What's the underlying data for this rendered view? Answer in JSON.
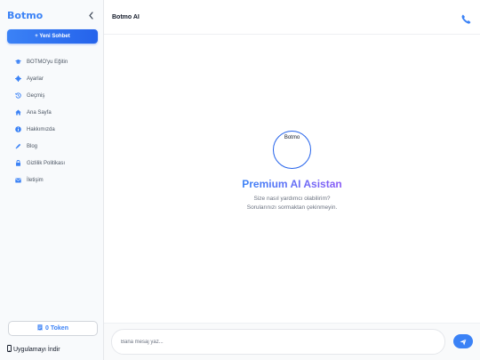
{
  "sidebar": {
    "brand": "Botmo",
    "new_chat_label": "+ Yeni Sohbet",
    "items": [
      {
        "label": "BOTMO'yu Eğitin",
        "icon": "graduation-cap-icon"
      },
      {
        "label": "Ayarlar",
        "icon": "gear-icon"
      },
      {
        "label": "Geçmiş",
        "icon": "history-icon"
      },
      {
        "label": "Ana Sayfa",
        "icon": "home-icon"
      },
      {
        "label": "Hakkımızda",
        "icon": "info-icon"
      },
      {
        "label": "Blog",
        "icon": "blog-icon"
      },
      {
        "label": "Gizlilik Politikası",
        "icon": "lock-icon"
      },
      {
        "label": "İletişim",
        "icon": "envelope-icon"
      }
    ],
    "token_label": "0 Token",
    "download_label": "Uygulamayı İndir"
  },
  "topbar": {
    "title": "Botmo AI"
  },
  "hero": {
    "logo_text": "Botmo",
    "title": "Premium AI Asistan",
    "subtitle_line1": "Size nasıl yardımcı olabilirim?",
    "subtitle_line2": "Sorularınızı sormaktan çekinmeyin."
  },
  "composer": {
    "placeholder": "Bana mesaj yaz...",
    "value": ""
  },
  "colors": {
    "accent": "#3b82f6",
    "accent_dark": "#2563eb",
    "gradient_end": "#8b5cf6"
  }
}
